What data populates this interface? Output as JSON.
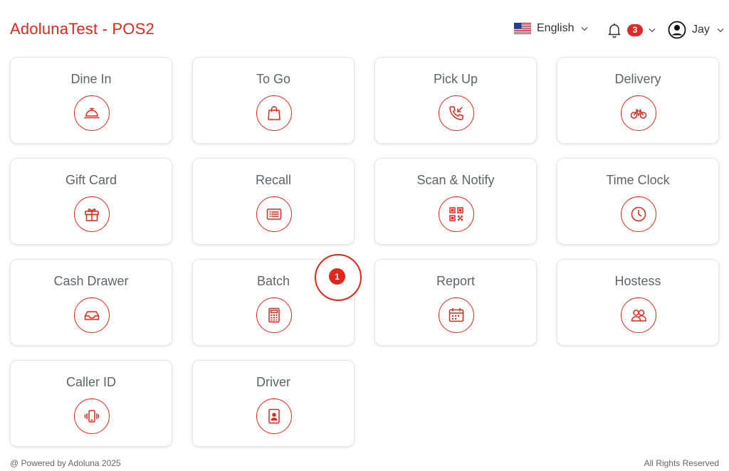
{
  "header": {
    "title": "AdolunaTest - POS2",
    "language": {
      "label": "English",
      "flag_icon": "us-flag-icon"
    },
    "notifications": {
      "count": "3",
      "icon": "bell-icon"
    },
    "user": {
      "name": "Jay",
      "icon": "user-circle-icon"
    }
  },
  "colors": {
    "accent": "#e3261b",
    "badge": "#dc2a2a",
    "label": "#5f6368"
  },
  "tiles": [
    {
      "label": "Dine In",
      "icon": "service-bell-icon"
    },
    {
      "label": "To Go",
      "icon": "shopping-bag-icon"
    },
    {
      "label": "Pick Up",
      "icon": "phone-incoming-icon"
    },
    {
      "label": "Delivery",
      "icon": "bicycle-icon"
    },
    {
      "label": "Gift Card",
      "icon": "gift-icon"
    },
    {
      "label": "Recall",
      "icon": "receipt-list-icon"
    },
    {
      "label": "Scan & Notify",
      "icon": "qr-code-icon"
    },
    {
      "label": "Time Clock",
      "icon": "clock-icon"
    },
    {
      "label": "Cash Drawer",
      "icon": "drawer-tray-icon"
    },
    {
      "label": "Batch",
      "icon": "calculator-icon"
    },
    {
      "label": "Report",
      "icon": "calendar-report-icon"
    },
    {
      "label": "Hostess",
      "icon": "users-icon"
    },
    {
      "label": "Caller ID",
      "icon": "vibrating-phone-icon"
    },
    {
      "label": "Driver",
      "icon": "driver-badge-icon"
    }
  ],
  "marker": {
    "number": "1"
  },
  "footer": {
    "left": "@ Powered by Adoluna 2025",
    "right": "All Rights Reserved"
  }
}
